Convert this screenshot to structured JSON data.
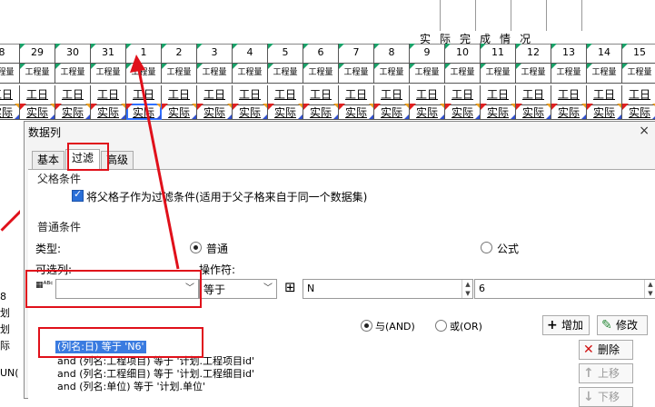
{
  "sheet": {
    "section_title": "实际完成情况",
    "day_numbers": [
      "8",
      "29",
      "30",
      "31",
      "1",
      "2",
      "3",
      "4",
      "5",
      "6",
      "7",
      "8",
      "9",
      "10",
      "11",
      "12",
      "13",
      "14",
      "15"
    ],
    "qty_label": "工程量",
    "workday_label": "工日",
    "actual_label": "实际",
    "left_fragments": [
      "8",
      "划",
      "划",
      "际",
      "UN("
    ]
  },
  "dialog": {
    "title": "数据列",
    "close_glyph": "×",
    "tabs": [
      "基本",
      "过滤",
      "高级"
    ],
    "active_tab": "过滤",
    "parent_section": "父格条件",
    "parent_checkbox_label": "将父格子作为过滤条件(适用于父子格来自于同一个数据集)",
    "common_section": "普通条件",
    "type_label": "类型:",
    "type_options": [
      "普通",
      "公式"
    ],
    "type_selected": "普通",
    "column_label": "可选列:",
    "column_value": "",
    "operator_label": "操作符:",
    "operator_value": "等于",
    "value_type_value": "N",
    "value_text": "6",
    "logic_options": [
      "与(AND)",
      "或(OR)"
    ],
    "logic_selected": "与(AND)",
    "add_button": "增加",
    "modify_button": "修改",
    "delete_button": "删除",
    "up_button": "上移",
    "down_button": "下移",
    "conditions": [
      "(列名:日) 等于 'N6'",
      "and (列名:工程项目) 等于 '计划.工程项目id'",
      "and (列名:工程细目) 等于 '计划.工程细目id'",
      "and (列名:单位) 等于 '计划.单位'"
    ]
  },
  "colors": {
    "annotation_red": "#e0101a",
    "selection_blue": "#3a7be0",
    "checkbox_blue": "#2a6fd8"
  }
}
